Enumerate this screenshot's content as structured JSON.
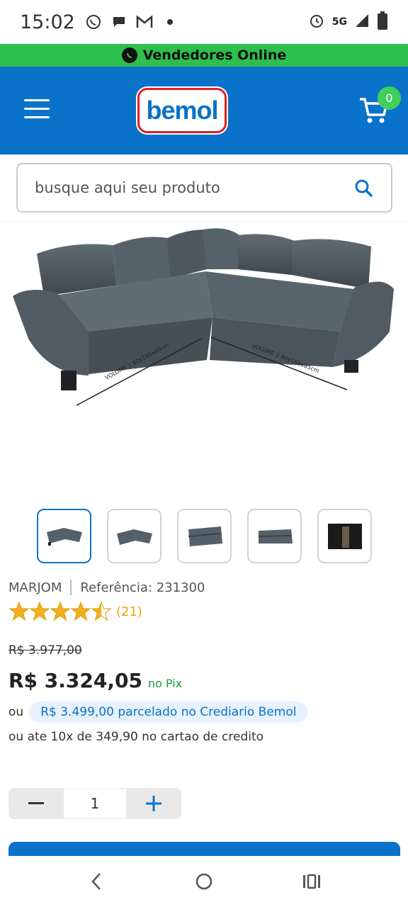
{
  "status": {
    "time": "15:02",
    "network": "5G"
  },
  "vendor_bar": {
    "label": "Vendedores Online"
  },
  "header": {
    "logo_text": "bemol",
    "cart_count": "0"
  },
  "search": {
    "placeholder": "busque aqui seu produto"
  },
  "product": {
    "image_labels": {
      "volume1": "VOLUME 1 80x160x85cm",
      "volume2": "VOLUME 2 80x160x85cm"
    },
    "brand": "MARJOM",
    "reference": "Referência: 231300",
    "rating_value": 4.5,
    "rating_count": "(21)",
    "old_price": "R$ 3.977,00",
    "price": "R$ 3.324,05",
    "price_method": "no Pix",
    "ou_label": "ou",
    "crediario": "R$ 3.499,00 parcelado no Crediario Bemol",
    "cartao": "ou ate 10x de 349,90 no cartao de credito",
    "quantity": "1"
  },
  "colors": {
    "brand_blue": "#0a72c8",
    "vendor_green": "#2fbf4f",
    "pix_green": "#1a9a3a",
    "star_gold": "#f2b01e"
  }
}
